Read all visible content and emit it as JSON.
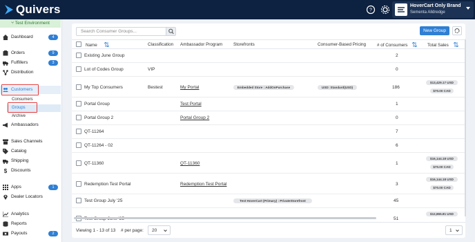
{
  "app": {
    "logo_text": "Quivers",
    "env_label": "Test Environment"
  },
  "header": {
    "brand_name": "HoverCart Only Brand",
    "user_name": "Sementa Alldredge"
  },
  "sidebar": {
    "items": [
      {
        "label": "Dashboard",
        "icon": "home-icon",
        "badge": "4"
      },
      {
        "label": "Orders",
        "icon": "orders-icon",
        "badge": "9"
      },
      {
        "label": "Fulfillers",
        "icon": "truck-icon",
        "badge": "3"
      },
      {
        "label": "Distribution",
        "icon": "distribution-icon",
        "badge": ""
      },
      {
        "label": "Customers",
        "icon": "users-icon",
        "badge": ""
      },
      {
        "label": "Ambassadors",
        "icon": "megaphone-icon",
        "badge": ""
      },
      {
        "label": "Sales Channels",
        "icon": "store-icon",
        "badge": ""
      },
      {
        "label": "Catalog",
        "icon": "tag-icon",
        "badge": ""
      },
      {
        "label": "Shipping",
        "icon": "shipping-icon",
        "badge": ""
      },
      {
        "label": "Discounts",
        "icon": "dollar-icon",
        "badge": ""
      },
      {
        "label": "Apps",
        "icon": "grid-icon",
        "badge": "1"
      },
      {
        "label": "Dealer Locators",
        "icon": "pin-icon",
        "badge": ""
      },
      {
        "label": "Analytics",
        "icon": "analytics-icon",
        "badge": ""
      },
      {
        "label": "Reports",
        "icon": "reports-icon",
        "badge": ""
      },
      {
        "label": "Payouts",
        "icon": "payouts-icon",
        "badge": "2"
      }
    ],
    "sub_items": [
      "Consumers",
      "Groups",
      "Archive"
    ]
  },
  "toolbar": {
    "search_placeholder": "Search Consumer Groups...",
    "new_group_label": "New Group"
  },
  "table": {
    "columns": [
      "Name",
      "Classification",
      "Ambassador Program",
      "Storefronts",
      "Consumer-Based Pricing",
      "# of Consumers",
      "Total Sales"
    ],
    "rows": [
      {
        "name": "Existing June Group",
        "classification": "",
        "program": "",
        "storefront": "",
        "pricing": "",
        "consumers": "2",
        "sales": []
      },
      {
        "name": "Lot of Codes Group",
        "classification": "VIP",
        "program": "",
        "storefront": "",
        "pricing": "",
        "consumers": "0",
        "sales": []
      },
      {
        "name": "My Top Consumers",
        "classification": "Bestest",
        "program": "My Portal",
        "storefront": "Embedded Store : AddOnPurchase",
        "pricing": "USD: Standard(USD)",
        "consumers": "186",
        "sales": [
          "$13,429.17 USD",
          "$70.00 CAD"
        ]
      },
      {
        "name": "Portal Group",
        "classification": "",
        "program": "Test Portal",
        "storefront": "",
        "pricing": "",
        "consumers": "1",
        "sales": []
      },
      {
        "name": "Portal Group 2",
        "classification": "",
        "program": "Portal Group 2",
        "storefront": "",
        "pricing": "",
        "consumers": "0",
        "sales": []
      },
      {
        "name": "QT-11264",
        "classification": "",
        "program": "",
        "storefront": "",
        "pricing": "",
        "consumers": "7",
        "sales": []
      },
      {
        "name": "QT-11264 - 02",
        "classification": "",
        "program": "",
        "storefront": "",
        "pricing": "",
        "consumers": "6",
        "sales": []
      },
      {
        "name": "QT-11360",
        "classification": "",
        "program": "QT-11360",
        "storefront": "",
        "pricing": "",
        "consumers": "1",
        "sales": [
          "$16,144.18 USD",
          "$70.00 CAD"
        ]
      },
      {
        "name": "Redemption Test Portal",
        "classification": "",
        "program": "Redemption Test Portal",
        "storefront": "",
        "pricing": "",
        "consumers": "3",
        "sales": [
          "$16,144.18 USD",
          "$70.00 CAD"
        ]
      },
      {
        "name": "Test Group July '25",
        "classification": "",
        "program": "",
        "storefront": "Test HoverCart (Primary) : PrivateStorefront",
        "pricing": "",
        "consumers": "45",
        "sales": []
      },
      {
        "name": "Test Group June '25",
        "classification": "",
        "program": "",
        "storefront": "",
        "pricing": "",
        "consumers": "51",
        "sales": [
          "$12,865.81 USD"
        ]
      }
    ]
  },
  "footer": {
    "viewing": "Viewing 1 - 13 of 13",
    "per_page_label": "# per page:",
    "per_page_value": "20",
    "page_value": "1"
  }
}
